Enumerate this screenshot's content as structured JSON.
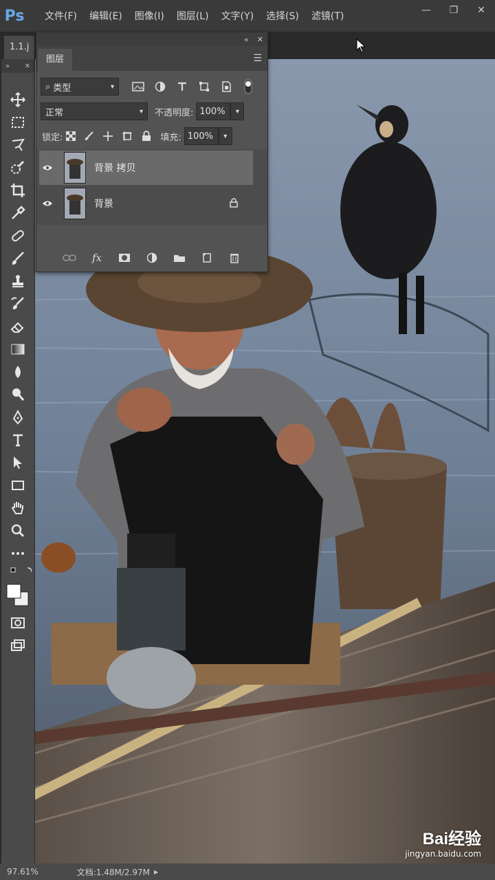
{
  "app": {
    "logo": "Ps"
  },
  "menubar": {
    "items": [
      "文件(F)",
      "编辑(E)",
      "图像(I)",
      "图层(L)",
      "文字(Y)",
      "选择(S)",
      "滤镜(T)"
    ]
  },
  "window_controls": {
    "minimize": "—",
    "restore": "❐",
    "close": "✕"
  },
  "document": {
    "tab_label": "1.1.j"
  },
  "layers_panel": {
    "tab_label": "图层",
    "filter_kind": "类型",
    "blend_mode": "正常",
    "opacity_label": "不透明度:",
    "opacity_value": "100%",
    "lock_label": "锁定:",
    "fill_label": "填充:",
    "fill_value": "100%",
    "layers": [
      {
        "name": "背景 拷贝",
        "selected": true,
        "locked": false
      },
      {
        "name": "背景",
        "selected": false,
        "locked": true
      }
    ]
  },
  "status": {
    "zoom": "97.61%",
    "doc_info": "文档:1.48M/2.97M"
  },
  "watermark": {
    "logo": "Bai经验",
    "url": "jingyan.baidu.com"
  }
}
